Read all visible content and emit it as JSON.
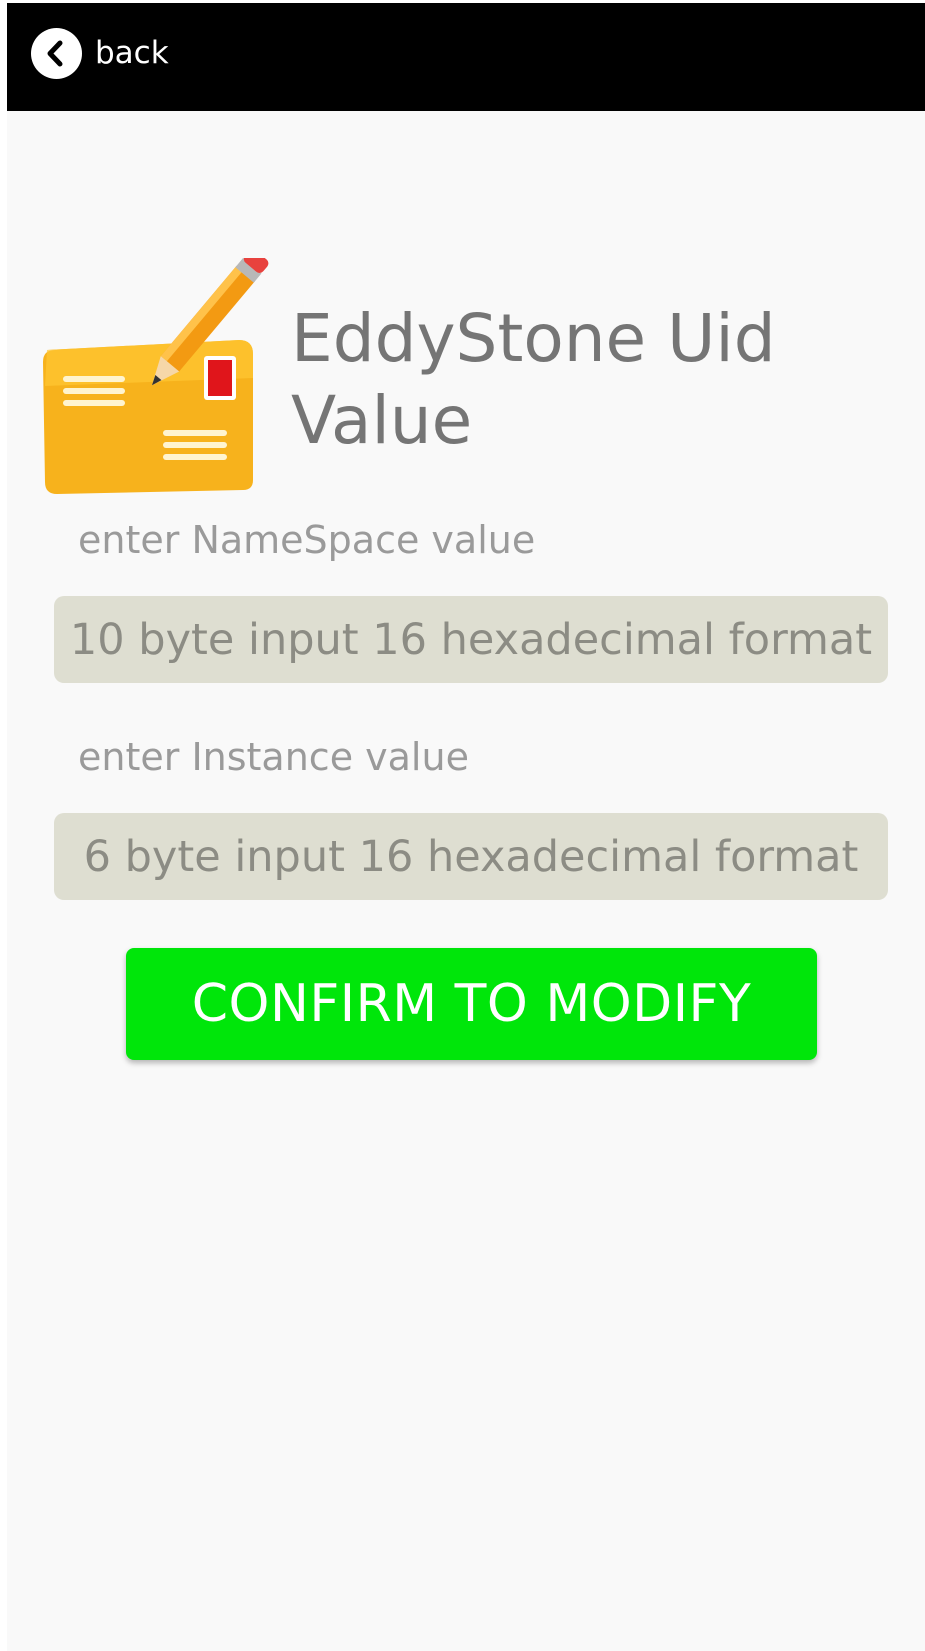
{
  "topbar": {
    "back_label": "back",
    "back_icon": "chevron-left-icon",
    "background": "#000000"
  },
  "header": {
    "icon": "mail-edit-icon",
    "title": "EddyStone Uid Value"
  },
  "form": {
    "namespace": {
      "label": "enter NameSpace value",
      "value": "",
      "placeholder": "10 byte input 16 hexadecimal format"
    },
    "instance": {
      "label": "enter Instance value",
      "value": "",
      "placeholder": "6 byte input 16 hexadecimal format"
    },
    "confirm_label": "CONFIRM TO MODIFY",
    "confirm_color": "#00e60a",
    "input_background": "#deded1"
  }
}
